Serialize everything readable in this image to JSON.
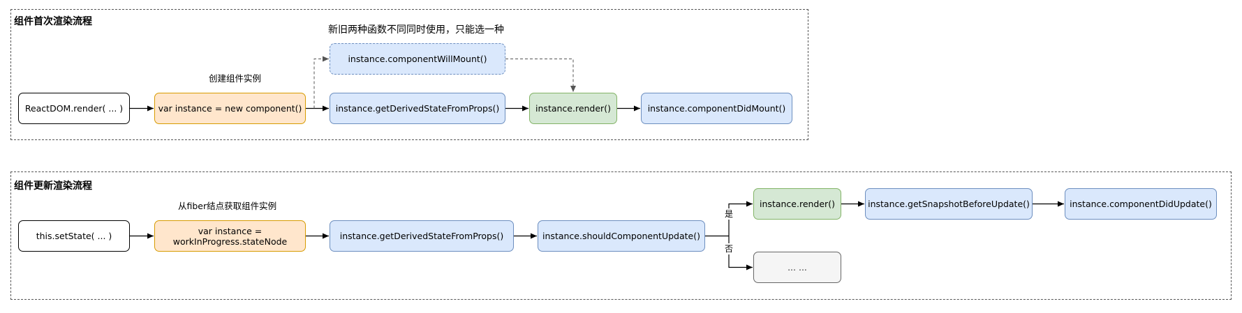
{
  "initial_flow": {
    "title": "组件首次渲染流程",
    "note": "新旧两种函数不同同时使用，只能选一种",
    "create_label": "创建组件实例",
    "nodes": {
      "reactdom_render": "ReactDOM.render( ... )",
      "new_instance": "var instance = new component()",
      "will_mount": "instance.componentWillMount()",
      "derived_state": "instance.getDerivedStateFromProps()",
      "render": "instance.render()",
      "did_mount": "instance.componentDidMount()"
    }
  },
  "update_flow": {
    "title": "组件更新渲染流程",
    "fiber_label": "从fiber结点获取组件实例",
    "yes_label": "是",
    "no_label": "否",
    "nodes": {
      "set_state": "this.setState( ... )",
      "instance_line1": "var instance =",
      "instance_line2": "workInProgress.stateNode",
      "derived_state": "instance.getDerivedStateFromProps()",
      "should_update": "instance.shouldComponentUpdate()",
      "render": "instance.render()",
      "snapshot": "instance.getSnapshotBeforeUpdate()",
      "did_update": "instance.componentDidUpdate()",
      "ellipsis": "... ..."
    }
  },
  "colors": {
    "orange_fill": "#ffe6cc",
    "orange_stroke": "#d79b00",
    "blue_fill": "#dae8fc",
    "blue_stroke": "#6c8ebf",
    "green_fill": "#d5e8d4",
    "green_stroke": "#82b366",
    "grey_fill": "#f5f5f5",
    "grey_stroke": "#666666"
  }
}
